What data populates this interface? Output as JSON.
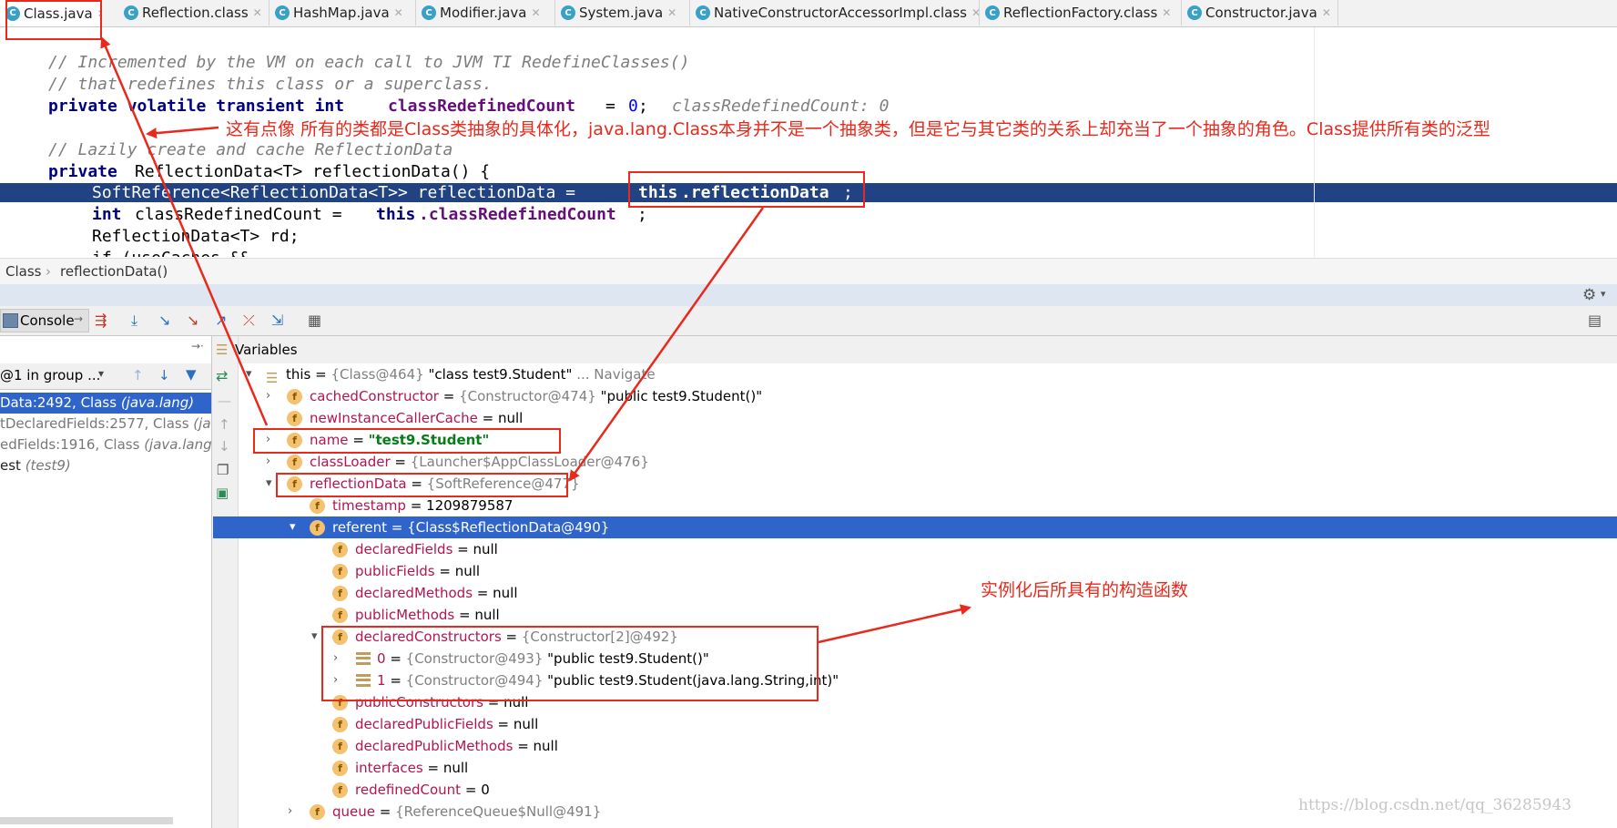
{
  "tabs": [
    {
      "label": "Class.java",
      "active": true
    },
    {
      "label": "Reflection.class"
    },
    {
      "label": "HashMap.java"
    },
    {
      "label": "Modifier.java"
    },
    {
      "label": "System.java"
    },
    {
      "label": "NativeConstructorAccessorImpl.class"
    },
    {
      "label": "ReflectionFactory.class"
    },
    {
      "label": "Constructor.java"
    }
  ],
  "editor": {
    "line1": "// Incremented by the VM on each call to JVM TI RedefineClasses()",
    "line2": "// that redefines this class or a superclass.",
    "line3_kw": "private volatile transient int",
    "line3_field": "classRedefinedCount",
    "line3_rest": "=",
    "line3_num": "0",
    "line3_semi": ";",
    "line3_hint": "classRedefinedCount: 0",
    "line4": "// Lazily create and cache ReflectionData",
    "line5_kw": "private",
    "line5_rest": "ReflectionData<T> reflectionData() {",
    "line6_a": "SoftReference<ReflectionData<T>> reflectionData = ",
    "line6_kw": "this",
    "line6_field": ".reflectionData",
    "line6_semi": ";",
    "line7_kw": "int",
    "line7_a": "classRedefinedCount = ",
    "line7_this": "this",
    "line7_field": ".classRedefinedCount",
    "line7_semi": ";",
    "line8": "ReflectionData<T> rd;",
    "line9": "if (useCaches &&"
  },
  "breadcrumb": {
    "root": "Class",
    "sep": "›",
    "method": "reflectionData()"
  },
  "debug": {
    "console_label": "Console",
    "variables_label": "Variables",
    "thread_selector": "@1 in group ...",
    "frames": [
      {
        "text": "Data:2492, Class ",
        "pkg": "(java.lang)",
        "selected": true
      },
      {
        "text": "tDeclaredFields:2577, Class ",
        "pkg": "(java"
      },
      {
        "text": "edFields:1916, Class ",
        "pkg": "(java.lang)"
      },
      {
        "text": "est ",
        "pkg": "(test9)"
      }
    ]
  },
  "variables": {
    "this": {
      "name": "this",
      "ref": "{Class@464}",
      "value": "\"class test9.Student\"",
      "extra": "... Navigate"
    },
    "cachedConstructor": {
      "name": "cachedConstructor",
      "ref": "{Constructor@474}",
      "value": "\"public test9.Student()\""
    },
    "newInstanceCallerCache": {
      "name": "newInstanceCallerCache",
      "value": "null"
    },
    "name": {
      "name": "name",
      "value": "\"test9.Student\""
    },
    "classLoader": {
      "name": "classLoader",
      "ref": "{Launcher$AppClassLoader@476}"
    },
    "reflectionData": {
      "name": "reflectionData",
      "ref": "{SoftReference@477}"
    },
    "timestamp": {
      "name": "timestamp",
      "value": "1209879587"
    },
    "referent": {
      "name": "referent",
      "ref": "{Class$ReflectionData@490}"
    },
    "declaredFields": {
      "name": "declaredFields",
      "value": "null"
    },
    "publicFields": {
      "name": "publicFields",
      "value": "null"
    },
    "declaredMethods": {
      "name": "declaredMethods",
      "value": "null"
    },
    "publicMethods": {
      "name": "publicMethods",
      "value": "null"
    },
    "declaredConstructors": {
      "name": "declaredConstructors",
      "ref": "{Constructor[2]@492}"
    },
    "ctor0": {
      "name": "0",
      "ref": "{Constructor@493}",
      "value": "\"public test9.Student()\""
    },
    "ctor1": {
      "name": "1",
      "ref": "{Constructor@494}",
      "value": "\"public test9.Student(java.lang.String,int)\""
    },
    "publicConstructors": {
      "name": "publicConstructors",
      "value": "null"
    },
    "declaredPublicFields": {
      "name": "declaredPublicFields",
      "value": "null"
    },
    "declaredPublicMethods": {
      "name": "declaredPublicMethods",
      "value": "null"
    },
    "interfaces": {
      "name": "interfaces",
      "value": "null"
    },
    "redefinedCount": {
      "name": "redefinedCount",
      "value": "0"
    },
    "queue": {
      "name": "queue",
      "ref": "{ReferenceQueue$Null@491}"
    }
  },
  "annotations": {
    "class_note": "这有点像  所有的类都是Class类抽象的具体化，java.lang.Class本身并不是一个抽象类，但是它与其它类的关系上却充当了一个抽象的角色。Class提供所有类的泛型",
    "ctor_note": "实例化后所具有的构造函数"
  },
  "watermark": "https://blog.csdn.net/qq_36285943",
  "colors": {
    "selection": "#2f65ca",
    "editor_selection": "#214283",
    "annotation": "#e8291c",
    "keyword": "#000080",
    "field": "#660e7a",
    "string": "#067d17"
  }
}
